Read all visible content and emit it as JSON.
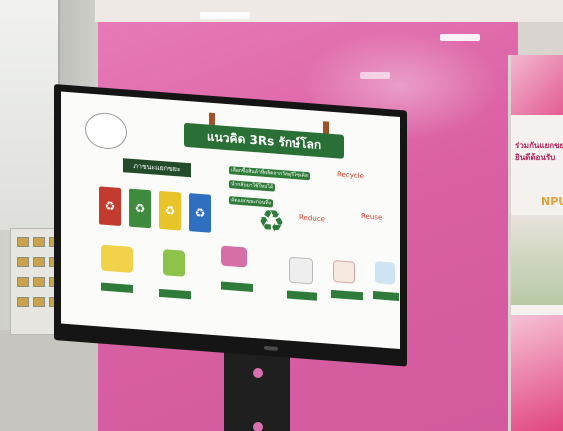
{
  "signage": {
    "title": "แนวคิด 3Rs รักษ์โลก",
    "section_label": "ภาชนะแยกขยะ",
    "recycle_label": "Recycle",
    "reduce_label": "Reduce",
    "reuse_label": "Reuse",
    "small_tags": [
      "เลือกซื้อสินค้าที่ผลิตจากวัสดุรีไซเคิล",
      "นำกลับมาใช้ใหม่ได้",
      "คัดแยกขยะก่อนทิ้ง"
    ]
  },
  "poster": {
    "line1": "ร่วมกันแยกขยะ",
    "line2": "ยินดีต้อนรับ",
    "brand": "NPU"
  },
  "colors": {
    "wall": "#da5fa3",
    "screen_green": "#2a6f36",
    "bin_red": "#c23b2e",
    "bin_green": "#3f8a3c",
    "bin_yellow": "#e8c42a",
    "bin_blue": "#2f6fbf"
  }
}
